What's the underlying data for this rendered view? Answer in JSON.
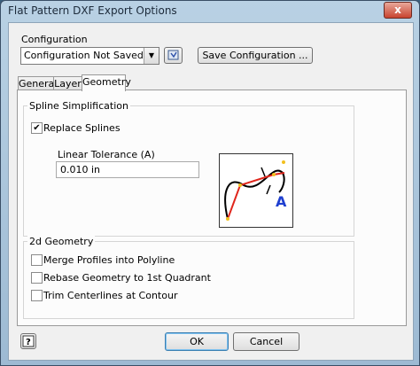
{
  "window": {
    "title": "Flat Pattern DXF Export Options",
    "close_glyph": "x"
  },
  "configuration": {
    "label": "Configuration",
    "selected": "Configuration Not Saved",
    "save_button": "Save Configuration ..."
  },
  "tabs": [
    {
      "label": "General"
    },
    {
      "label": "Layer"
    },
    {
      "label": "Geometry",
      "active": true
    }
  ],
  "spline": {
    "group_title": "Spline Simplification",
    "replace_label": "Replace Splines",
    "replace_checked": true,
    "tolerance_label": "Linear Tolerance (A)",
    "tolerance_value": "0.010 in",
    "diagram_letter": "A"
  },
  "geometry2d": {
    "group_title": "2d Geometry",
    "options": [
      {
        "label": "Merge Profiles into Polyline",
        "checked": false
      },
      {
        "label": "Rebase Geometry to 1st Quadrant",
        "checked": false
      },
      {
        "label": "Trim Centerlines at Contour",
        "checked": false
      }
    ]
  },
  "footer": {
    "ok": "OK",
    "cancel": "Cancel"
  },
  "icons": {
    "help": "help-icon",
    "load": "load-config-icon"
  },
  "colors": {
    "diagram_red": "#e0261c",
    "diagram_blue": "#1f3fd0",
    "diagram_dots": "#f2c01e"
  }
}
